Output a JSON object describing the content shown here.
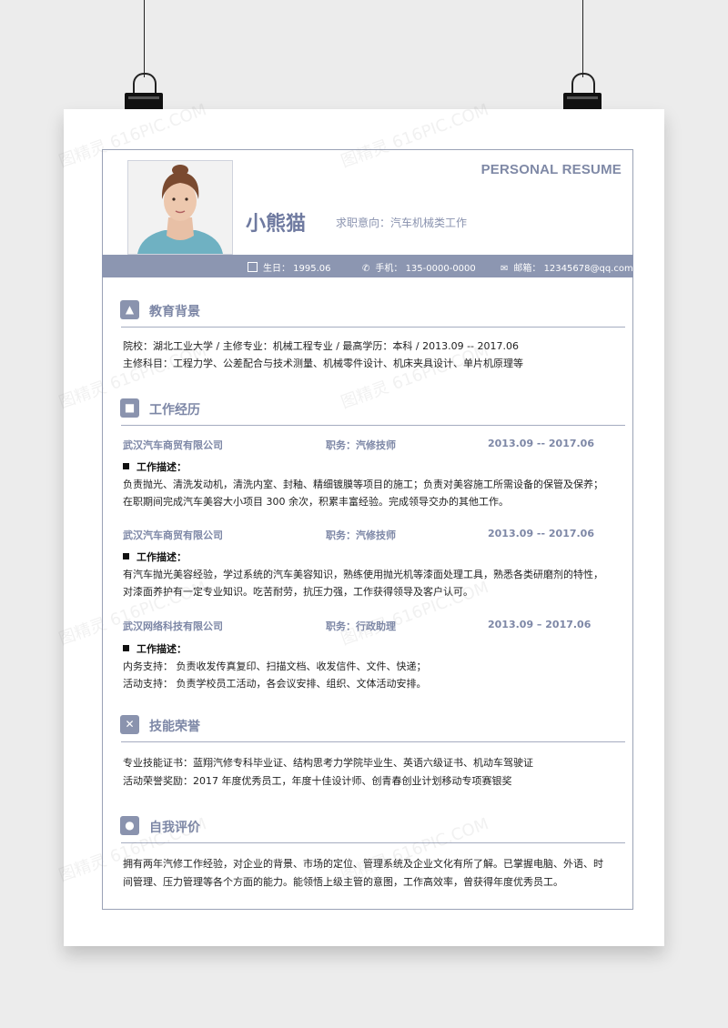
{
  "header": {
    "title_en": "PERSONAL RESUME",
    "name": "小熊猫",
    "intent": "求职意向：汽车机械类工作"
  },
  "basic_info": {
    "birthday": "生日： 1995.06",
    "phone": "手机： 135-0000-0000",
    "email": "邮箱： 12345678@qq.com"
  },
  "education": {
    "title": "教育背景",
    "line1": "院校：湖北工业大学    /   主修专业：机械工程专业     /     最高学历：本科      /      2013.09 -- 2017.06",
    "line2": "主修科目：工程力学、公差配合与技术测量、机械零件设计、机床夹具设计、单片机原理等"
  },
  "work": {
    "title": "工作经历",
    "jobs": [
      {
        "company": "武汉汽车商贸有限公司",
        "position": "职务：汽修技师",
        "date": "2013.09 -- 2017.06",
        "desc_label": "工作描述：",
        "desc1": "负责抛光、清洗发动机，清洗内室、封釉、精细镀膜等项目的施工；负责对美容施工所需设备的保管及保养；",
        "desc2": "在职期间完成汽车美容大小项目 300 余次，积累丰富经验。完成领导交办的其他工作。"
      },
      {
        "company": "武汉汽车商贸有限公司",
        "position": "职务：汽修技师",
        "date": "2013.09 -- 2017.06",
        "desc_label": "工作描述：",
        "desc1": "有汽车抛光美容经验，学过系统的汽车美容知识，熟练使用抛光机等漆面处理工具，熟悉各类研磨剂的特性，",
        "desc2": "对漆面养护有一定专业知识。吃苦耐劳，抗压力强，工作获得领导及客户认可。"
      },
      {
        "company": "武汉网络科技有限公司",
        "position": "职务：行政助理",
        "date": "2013.09 – 2017.06",
        "desc_label": "工作描述：",
        "desc1": "内务支持：   负责收发传真复印、扫描文档、收发信件、文件、快递；",
        "desc2": "活动支持：   负责学校员工活动，各会议安排、组织、文体活动安排。"
      }
    ]
  },
  "skills": {
    "title": "技能荣誉",
    "line1": "专业技能证书：蓝翔汽修专科毕业证、结构思考力学院毕业生、英语六级证书、机动车驾驶证",
    "line2": "活动荣誉奖励：2017 年度优秀员工，年度十佳设计师、创青春创业计划移动专项赛银奖"
  },
  "self": {
    "title": "自我评价",
    "line1": "拥有两年汽修工作经验，对企业的背景、市场的定位、管理系统及企业文化有所了解。已掌握电脑、外语、时",
    "line2": "间管理、压力管理等各个方面的能力。能领悟上级主管的意图，工作高效率，曾获得年度优秀员工。"
  },
  "watermark": "图精灵 616PIC.COM",
  "colors": {
    "accent": "#8c96b1",
    "title": "#7d87a6"
  }
}
